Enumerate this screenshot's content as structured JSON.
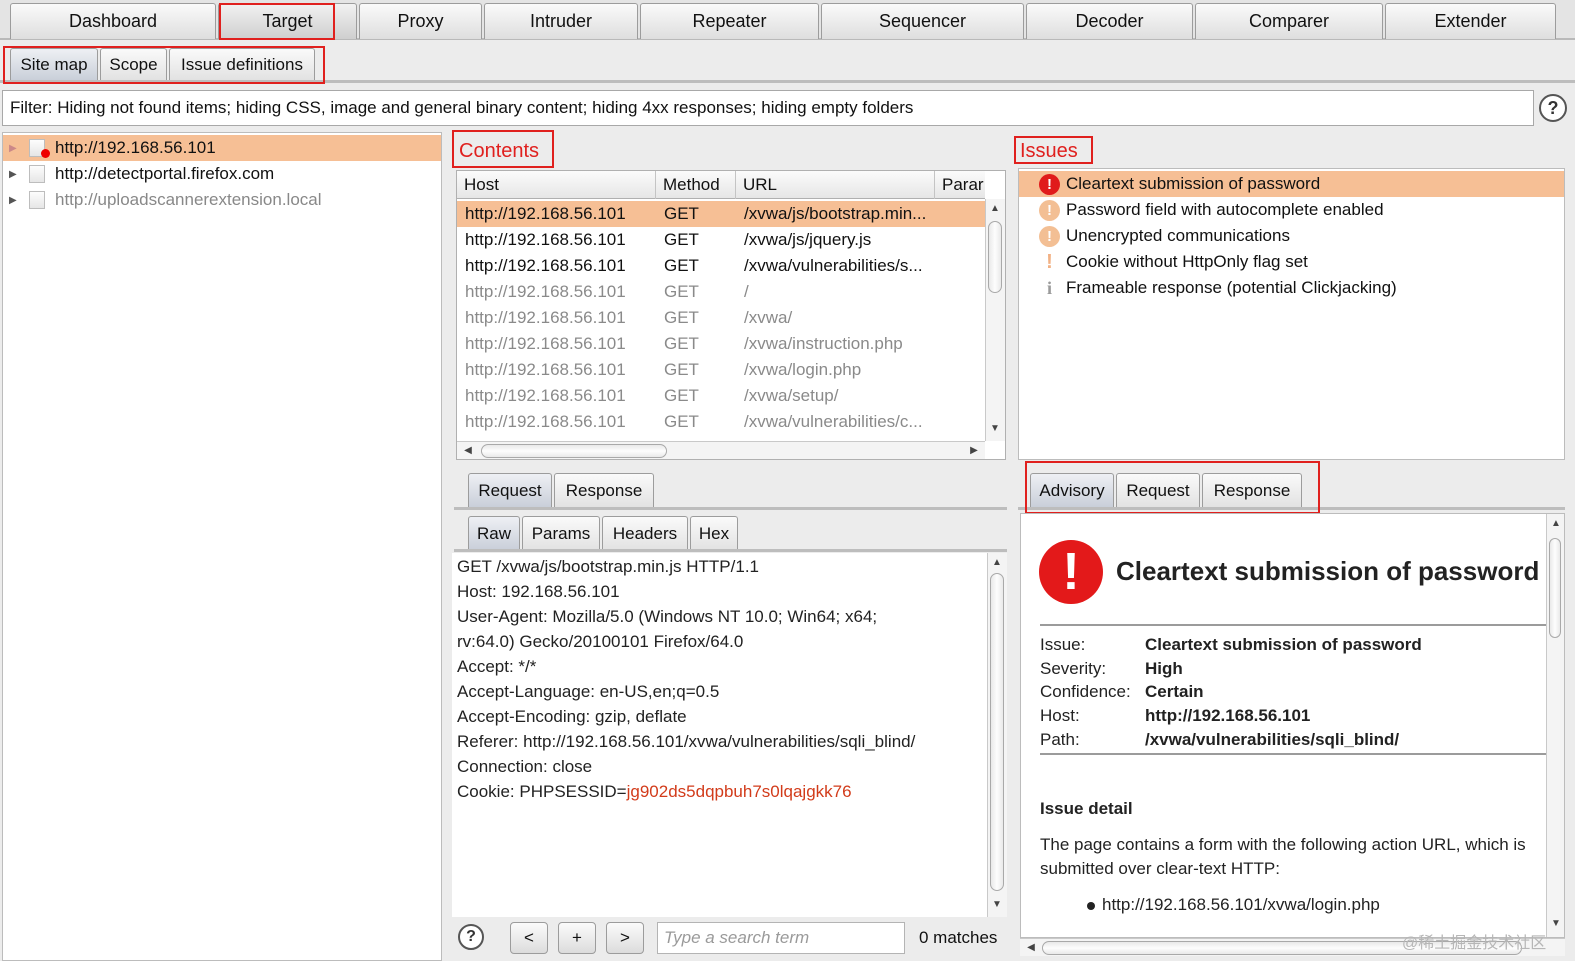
{
  "main_tabs": [
    "Dashboard",
    "Target",
    "Proxy",
    "Intruder",
    "Repeater",
    "Sequencer",
    "Decoder",
    "Comparer",
    "Extender"
  ],
  "sub_tabs": [
    "Site map",
    "Scope",
    "Issue definitions"
  ],
  "filter_text": "Filter: Hiding not found items;  hiding CSS, image and general binary content;  hiding 4xx responses;  hiding empty folders",
  "help_label": "?",
  "site_tree": [
    {
      "label": "http://192.168.56.101",
      "selected": true
    },
    {
      "label": "http://detectportal.firefox.com",
      "selected": false
    },
    {
      "label": "http://uploadscannerextension.local",
      "selected": false
    }
  ],
  "contents": {
    "title": "Contents",
    "columns": [
      "Host",
      "Method",
      "URL",
      "Parar"
    ],
    "rows": [
      [
        "http://192.168.56.101",
        "GET",
        "/xvwa/js/bootstrap.min..."
      ],
      [
        "http://192.168.56.101",
        "GET",
        "/xvwa/js/jquery.js"
      ],
      [
        "http://192.168.56.101",
        "GET",
        "/xvwa/vulnerabilities/s..."
      ],
      [
        "http://192.168.56.101",
        "GET",
        "/"
      ],
      [
        "http://192.168.56.101",
        "GET",
        "/xvwa/"
      ],
      [
        "http://192.168.56.101",
        "GET",
        "/xvwa/instruction.php"
      ],
      [
        "http://192.168.56.101",
        "GET",
        "/xvwa/login.php"
      ],
      [
        "http://192.168.56.101",
        "GET",
        "/xvwa/setup/"
      ],
      [
        "http://192.168.56.101",
        "GET",
        "/xvwa/vulnerabilities/c..."
      ]
    ]
  },
  "req_tabs": [
    "Request",
    "Response"
  ],
  "raw_tabs": [
    "Raw",
    "Params",
    "Headers",
    "Hex"
  ],
  "raw_request": {
    "lines": [
      "GET /xvwa/js/bootstrap.min.js HTTP/1.1",
      "Host: 192.168.56.101",
      "User-Agent: Mozilla/5.0 (Windows NT 10.0; Win64; x64;",
      "rv:64.0) Gecko/20100101 Firefox/64.0",
      "Accept: */*",
      "Accept-Language: en-US,en;q=0.5",
      "Accept-Encoding: gzip, deflate",
      "Referer: http://192.168.56.101/xvwa/vulnerabilities/sqli_blind/",
      "Connection: close"
    ],
    "cookie_prefix": "Cookie: PHPSESSID=",
    "cookie_value": "jg902ds5dqpbuh7s0lqajgkk76"
  },
  "search": {
    "help": "?",
    "prev": "<",
    "add": "+",
    "next": ">",
    "placeholder": "Type a search term",
    "matches": "0 matches"
  },
  "issues": {
    "title": "Issues",
    "items": [
      {
        "label": "Cleartext submission of password",
        "severity": "high",
        "icon": "!"
      },
      {
        "label": "Password field with autocomplete enabled",
        "severity": "medium",
        "icon": "!"
      },
      {
        "label": "Unencrypted communications",
        "severity": "medium",
        "icon": "!"
      },
      {
        "label": "Cookie without HttpOnly flag set",
        "severity": "low",
        "icon": "!"
      },
      {
        "label": "Frameable response (potential Clickjacking)",
        "severity": "info",
        "icon": "i"
      }
    ]
  },
  "adv_tabs": [
    "Advisory",
    "Request",
    "Response"
  ],
  "advisory": {
    "icon": "!",
    "title": "Cleartext submission of password",
    "fields": [
      {
        "key": "Issue:",
        "value": "Cleartext submission of password"
      },
      {
        "key": "Severity:",
        "value": "High"
      },
      {
        "key": "Confidence:",
        "value": "Certain"
      },
      {
        "key": "Host:",
        "value": "http://192.168.56.101"
      },
      {
        "key": "Path:",
        "value": "/xvwa/vulnerabilities/sqli_blind/"
      }
    ],
    "detail_heading": "Issue detail",
    "detail_line1": "The page contains a form with the following action URL, which is",
    "detail_line2": "submitted over clear-text HTTP:",
    "detail_bullet": "http://192.168.56.101/xvwa/login.php"
  },
  "watermark": "@稀土掘金技术社区",
  "colors": {
    "selection": "#f6bf95",
    "highlight_box": "#e0201e",
    "severity_high": "#e01b1b",
    "severity_medium": "#f3bf94",
    "cookie_value": "#d23b1a"
  }
}
